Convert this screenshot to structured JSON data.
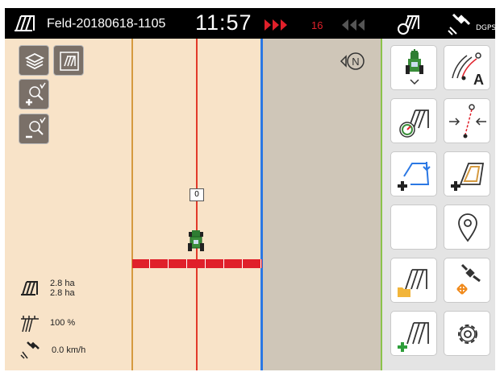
{
  "topbar": {
    "field_name": "Feld-20180618-1105",
    "time": "11:57",
    "section_count": "16",
    "gps_label": "DGPS"
  },
  "map": {
    "track_label": "0",
    "compass_label": "N"
  },
  "stats": {
    "area_total": "2.8 ha",
    "area_worked": "2.8 ha",
    "rate": "100 %",
    "speed": "0.0 km/h"
  },
  "colors": {
    "field": "#f8e3c8",
    "outside": "#cfc6b8",
    "guidance_red": "#e23a2a",
    "boundary_blue": "#2b78e4",
    "accent_green": "#8bc34a"
  }
}
